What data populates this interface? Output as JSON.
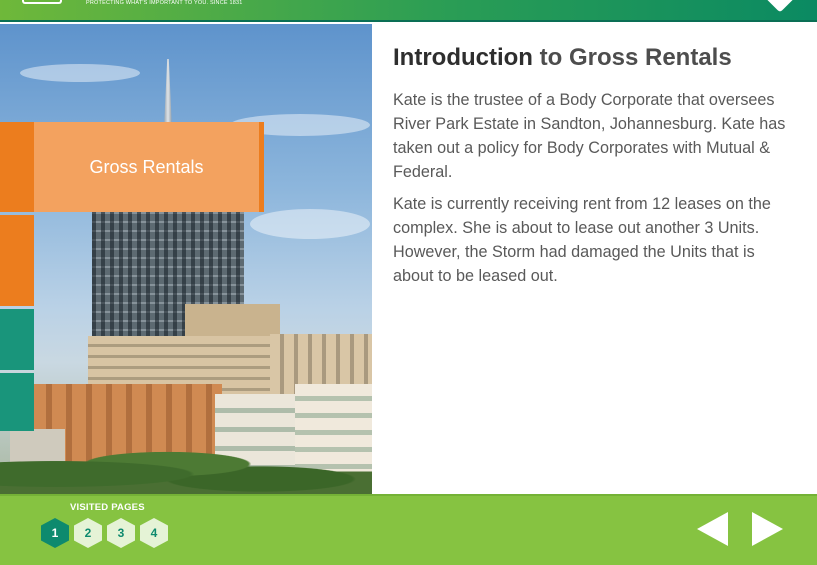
{
  "header": {
    "tagline": "PROTECTING WHAT'S IMPORTANT TO YOU. SINCE 1831"
  },
  "sidebar": {
    "title_card": "Gross Rentals"
  },
  "main": {
    "heading_strong": "Introduction",
    "heading_rest": " to Gross Rentals",
    "paragraphs": [
      "Kate is the trustee of a Body Corporate that oversees River Park Estate in Sandton, Johannesburg. Kate has taken out a policy for Body Corporates with Mutual & Federal.",
      "Kate is currently receiving rent from 12 leases on the complex. She is about to lease out another 3 Units. However, the Storm had damaged the Units that is about to be leased out."
    ]
  },
  "footer": {
    "visited_label": "VISITED PAGES",
    "pages": [
      "1",
      "2",
      "3",
      "4"
    ],
    "current_page": "1"
  },
  "colors": {
    "header_green": "#2a9d55",
    "footer_green": "#86c341",
    "orange": "#ec7d1e",
    "teal": "#19957b"
  }
}
